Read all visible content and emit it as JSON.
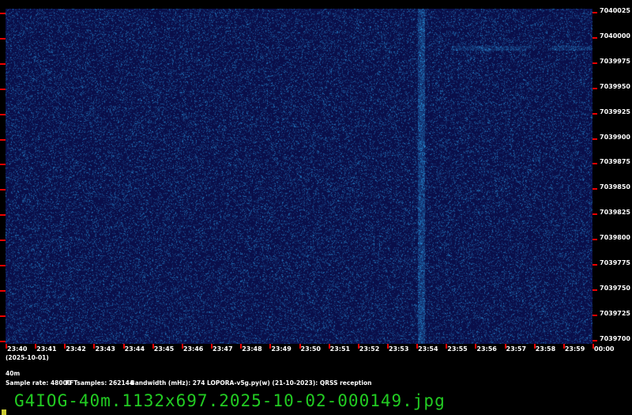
{
  "waterfall": {
    "freq_labels": [
      "7040025",
      "7040000",
      "7039975",
      "7039950",
      "7039925",
      "7039900",
      "7039875",
      "7039850",
      "7039825",
      "7039800",
      "7039775",
      "7039750",
      "7039725",
      "7039700"
    ],
    "time_labels": [
      "23:40",
      "23:41",
      "23:42",
      "23:43",
      "23:44",
      "23:45",
      "23:46",
      "23:47",
      "23:48",
      "23:49",
      "23:50",
      "23:51",
      "23:52",
      "23:53",
      "23:54",
      "23:55",
      "23:56",
      "23:57",
      "23:58",
      "23:59",
      "00:00"
    ],
    "date": "(2025-10-01)",
    "colors": {
      "background": "#0a0f4a",
      "tick": "#ee0000",
      "signal": "#3a8aa0"
    }
  },
  "info": {
    "band": "40m",
    "sample_rate": "Sample rate: 48000",
    "fft_samples": "FFTsamples: 262144",
    "bandwidth": "Bandwidth (mHz): 274",
    "software": "LOPORA-v5g.py(w) (21-10-2023): QRSS reception"
  },
  "filename": "G4IOG-40m.1132x697.2025-10-02-000149.jpg"
}
